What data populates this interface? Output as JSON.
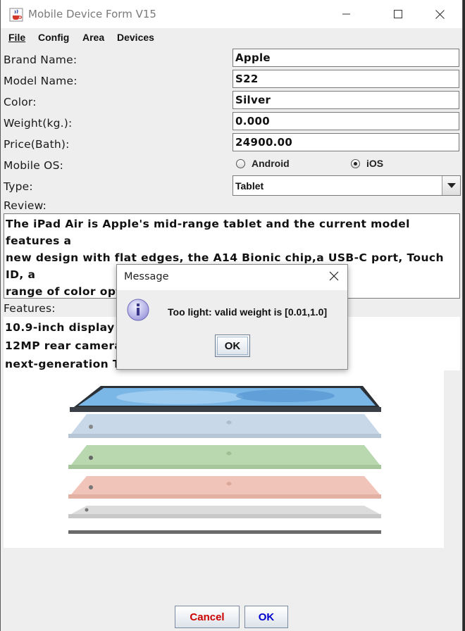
{
  "window": {
    "title": "Mobile Device Form V15",
    "icon": "java-cup-icon"
  },
  "menu": {
    "file": "File",
    "config": "Config",
    "area": "Area",
    "devices": "Devices"
  },
  "form": {
    "brand": {
      "label": "Brand Name:",
      "value": "Apple"
    },
    "model": {
      "label": "Model Name:",
      "value": "S22"
    },
    "color": {
      "label": "Color:",
      "value": "Silver"
    },
    "weight": {
      "label": "Weight(kg.):",
      "value": "0.000"
    },
    "price": {
      "label": "Price(Bath):",
      "value": "24900.00"
    },
    "os": {
      "label": "Mobile OS:",
      "options": [
        "Android",
        "iOS"
      ],
      "selected": "iOS"
    },
    "type": {
      "label": "Type:",
      "value": "Tablet"
    },
    "review": {
      "label": "Review:",
      "lines": [
        "The iPad Air is Apple's mid-range tablet and the current model features a",
        "new design with flat edges, the A14 Bionic chip,a USB-C port, Touch ID, a",
        "range of color options, and more."
      ]
    },
    "features": {
      "label": "Features:",
      "items": [
        "10.9-inch display",
        "12MP rear camera",
        "next-generation To"
      ]
    }
  },
  "buttons": {
    "cancel": "Cancel",
    "ok": "OK"
  },
  "dialog": {
    "title": "Message",
    "message": "Too light: valid weight is [0.01,1.0]",
    "ok": "OK",
    "icon": "info-icon"
  },
  "colors": {
    "cancel_text": "#cc0000",
    "ok_text": "#0000cc",
    "tablet_colors": [
      "#7ab6e6",
      "#c9d8e8",
      "#b9d8b0",
      "#f0c4b8",
      "#d8d8d8",
      "#6a6a6a"
    ]
  }
}
